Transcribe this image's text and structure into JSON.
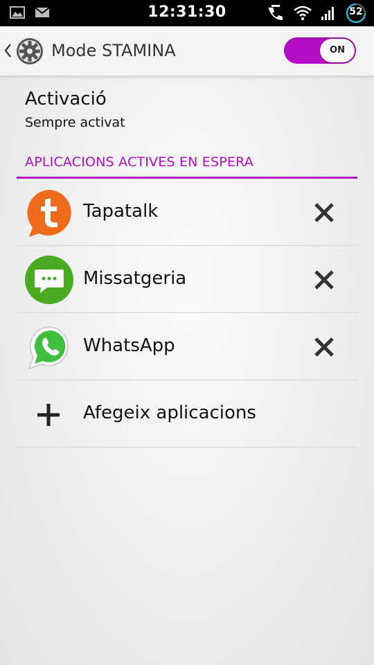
{
  "status_bar": {
    "time": "12:31:30",
    "battery_level": "52",
    "left_icons": [
      "image-icon",
      "mail-icon"
    ],
    "right_icons": [
      "phone-in-talk-icon",
      "wifi-icon",
      "signal-icon",
      "battery-icon"
    ]
  },
  "action_bar": {
    "title": "Mode STAMINA",
    "icon": "gear-icon",
    "toggle_label": "ON",
    "toggle_state": true
  },
  "activation": {
    "title": "Activació",
    "value": "Sempre activat"
  },
  "section_header": "APLICACIONS ACTIVES EN ESPERA",
  "apps": [
    {
      "name": "Tapatalk",
      "icon": "tapatalk-icon"
    },
    {
      "name": "Missatgeria",
      "icon": "messaging-icon"
    },
    {
      "name": "WhatsApp",
      "icon": "whatsapp-icon"
    }
  ],
  "add_apps_label": "Afegeix aplicacions",
  "colors": {
    "accent": "#b40ec4",
    "tapatalk": "#f06a1e",
    "messaging": "#4aaa22",
    "whatsapp": "#3fbf3c"
  }
}
